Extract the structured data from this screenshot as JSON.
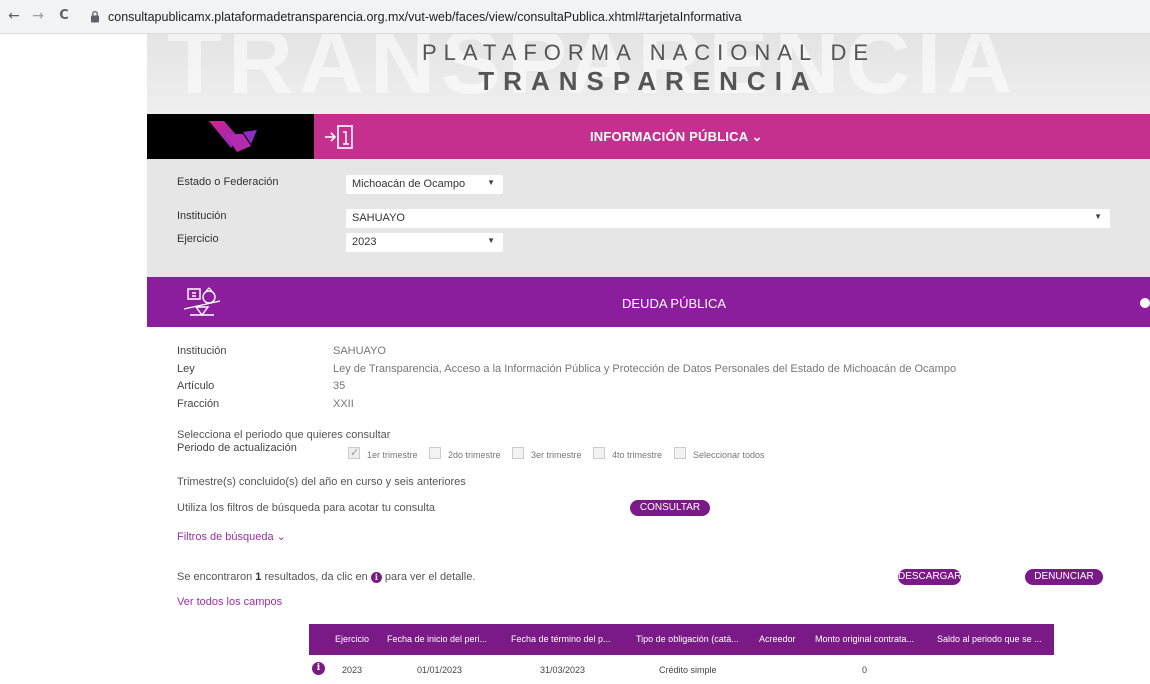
{
  "browser": {
    "url": "consultapublicamx.plataformadetransparencia.org.mx/vut-web/faces/view/consultaPublica.xhtml#tarjetaInformativa",
    "back_icon": "←",
    "forward_icon": "→",
    "reload_icon": "C"
  },
  "banner": {
    "line1": "PLATAFORMA NACIONAL DE",
    "line2": "TRANSPARENCIA",
    "ghost": "TRANSPARENCIA"
  },
  "navbar": {
    "menu_label": "INFORMACIÓN PÚBLICA ⌄"
  },
  "form": {
    "estado_label": "Estado o Federación",
    "estado_value": "Michoacán de Ocampo",
    "institucion_label": "Institución",
    "institucion_value": "SAHUAYO",
    "ejercicio_label": "Ejercicio",
    "ejercicio_value": "2023",
    "arrow": "▼"
  },
  "section": {
    "title": "DEUDA PÚBLICA"
  },
  "detail": {
    "institucion_label": "Institución",
    "institucion_value": "SAHUAYO",
    "ley_label": "Ley",
    "ley_value": "Ley de Transparencia, Acceso a la Información Pública y Protección de Datos Personales del Estado de Michoacán de Ocampo",
    "articulo_label": "Artículo",
    "articulo_value": "35",
    "fraccion_label": "Fracción",
    "fraccion_value": "XXII"
  },
  "periodo": {
    "prompt": "Selecciona el periodo que quieres consultar",
    "label": "Periodo de actualización",
    "options": [
      "1er trimestre",
      "2do trimestre",
      "3er trimestre",
      "4to trimestre",
      "Seleccionar todos"
    ],
    "checkmark": "✓",
    "note": "Trimestre(s) concluido(s) del año en curso y seis anteriores"
  },
  "consulta": {
    "hint": "Utiliza los filtros de búsqueda para acotar tu consulta",
    "button": "CONSULTAR",
    "filters_link": "Filtros de búsqueda ⌄"
  },
  "results": {
    "prefix": "Se encontraron ",
    "count": "1",
    "suffix_a": " resultados, da clic en ",
    "suffix_b": " para ver el detalle.",
    "info_glyph": "i",
    "download_button": "DESCARGAR",
    "report_button": "DENUNCIAR",
    "all_fields_link": "Ver todos los campos"
  },
  "table": {
    "headers": [
      "Ejercicio",
      "Fecha de inicio del peri...",
      "Fecha de término del p...",
      "Tipo de obligación (catá...",
      "Acreedor",
      "Monto original contrata...",
      "Saldo al periodo que se ..."
    ],
    "rows": [
      [
        "2023",
        "01/01/2023",
        "31/03/2023",
        "Crédito simple",
        "",
        "0",
        ""
      ]
    ]
  }
}
